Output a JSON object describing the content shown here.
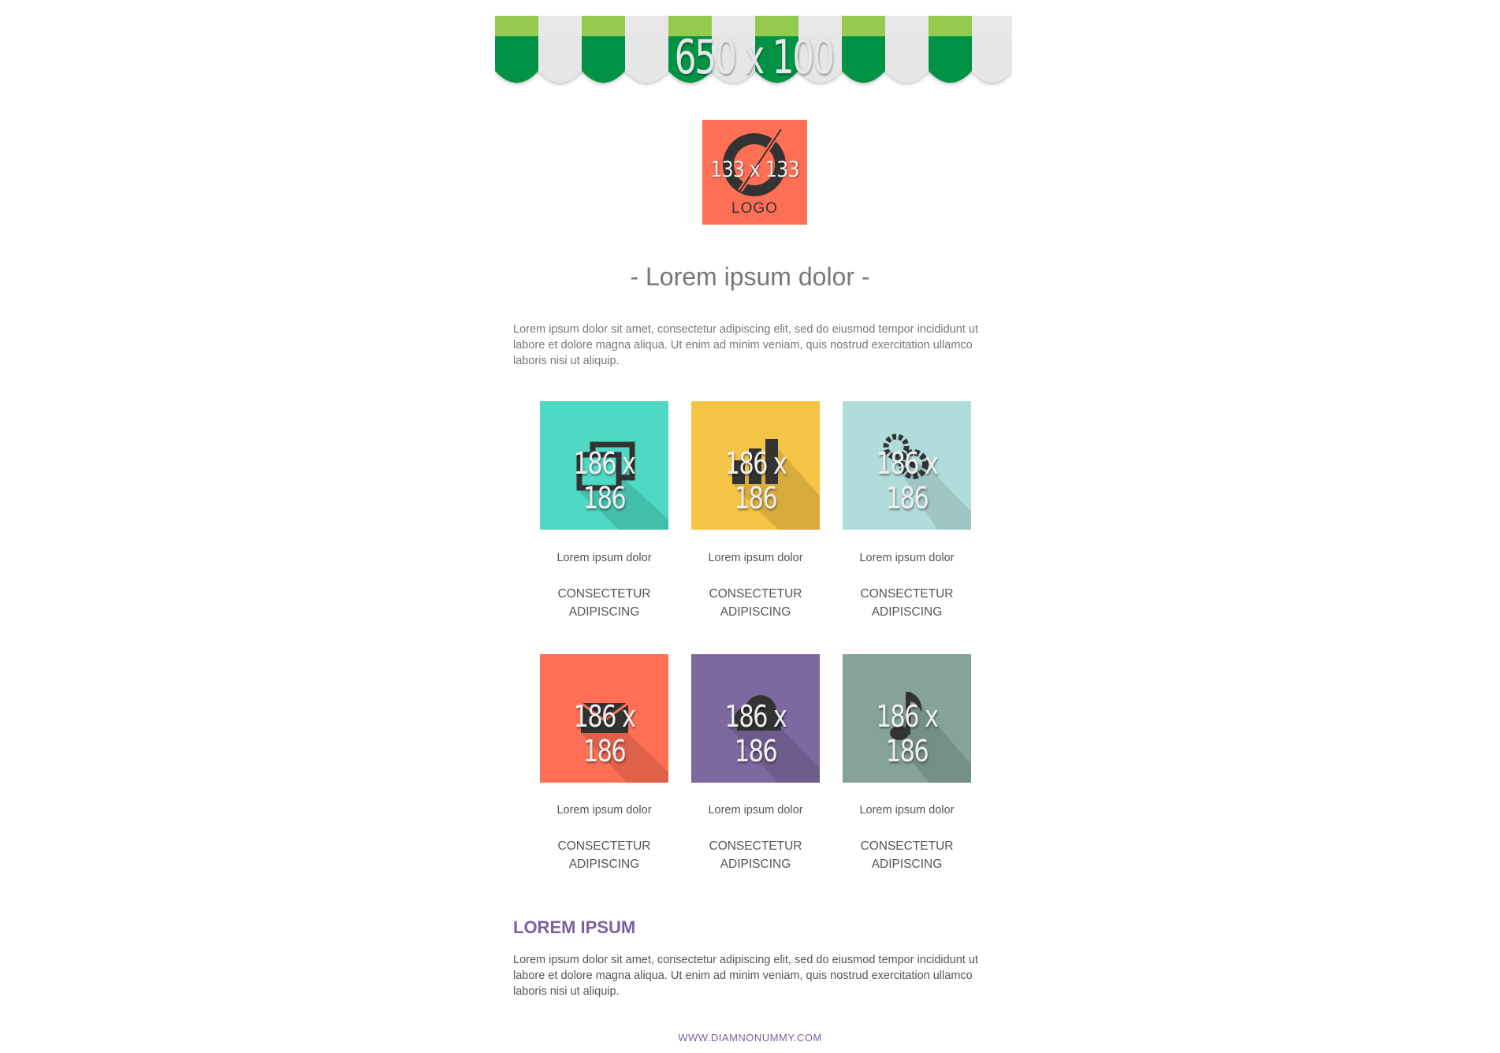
{
  "banner": {
    "text": "650 x 100",
    "colors": {
      "green_top": "#8cc63f",
      "green": "#009245",
      "white": "#e6e6e6"
    }
  },
  "logo": {
    "dimensions": "133 x 133",
    "word": "LOGO",
    "background": "#ff6f55"
  },
  "title": "- Lorem ipsum dolor -",
  "intro": "Lorem ipsum dolor sit amet, consectetur adipiscing elit, sed do eiusmod tempor incididunt ut labore et dolore magna aliqua. Ut enim ad minim veniam, quis nostrud exercitation ullamco laboris nisi ut aliquip.",
  "tiles": [
    {
      "dimensions": "186 x 186",
      "icon": "photos-icon",
      "color": "#4dd9c3",
      "label": "Lorem ipsum dolor",
      "cta_line1": "CONSECTETUR",
      "cta_line2": "ADIPISCING"
    },
    {
      "dimensions": "186 x 186",
      "icon": "bar-chart-icon",
      "color": "#f6c445",
      "label": "Lorem ipsum dolor",
      "cta_line1": "CONSECTETUR",
      "cta_line2": "ADIPISCING"
    },
    {
      "dimensions": "186 x 186",
      "icon": "gears-icon",
      "color": "#b1dcdc",
      "label": "Lorem ipsum dolor",
      "cta_line1": "CONSECTETUR",
      "cta_line2": "ADIPISCING"
    },
    {
      "dimensions": "186 x 186",
      "icon": "envelope-icon",
      "color": "#ff6f55",
      "label": "Lorem ipsum dolor",
      "cta_line1": "CONSECTETUR",
      "cta_line2": "ADIPISCING"
    },
    {
      "dimensions": "186 x 186",
      "icon": "cloud-icon",
      "color": "#7d68a0",
      "label": "Lorem ipsum dolor",
      "cta_line1": "CONSECTETUR",
      "cta_line2": "ADIPISCING"
    },
    {
      "dimensions": "186 x 186",
      "icon": "music-note-icon",
      "color": "#86a399",
      "label": "Lorem ipsum dolor",
      "cta_line1": "CONSECTETUR",
      "cta_line2": "ADIPISCING"
    }
  ],
  "section": {
    "heading": "LOREM IPSUM",
    "body": "Lorem ipsum dolor sit amet, consectetur adipiscing elit, sed do eiusmod tempor incididunt ut labore et dolore magna aliqua. Ut enim ad minim veniam, quis nostrud exercitation ullamco laboris nisi ut aliquip."
  },
  "footer": {
    "link": "WWW.DIAMNONUMMY.COM"
  }
}
